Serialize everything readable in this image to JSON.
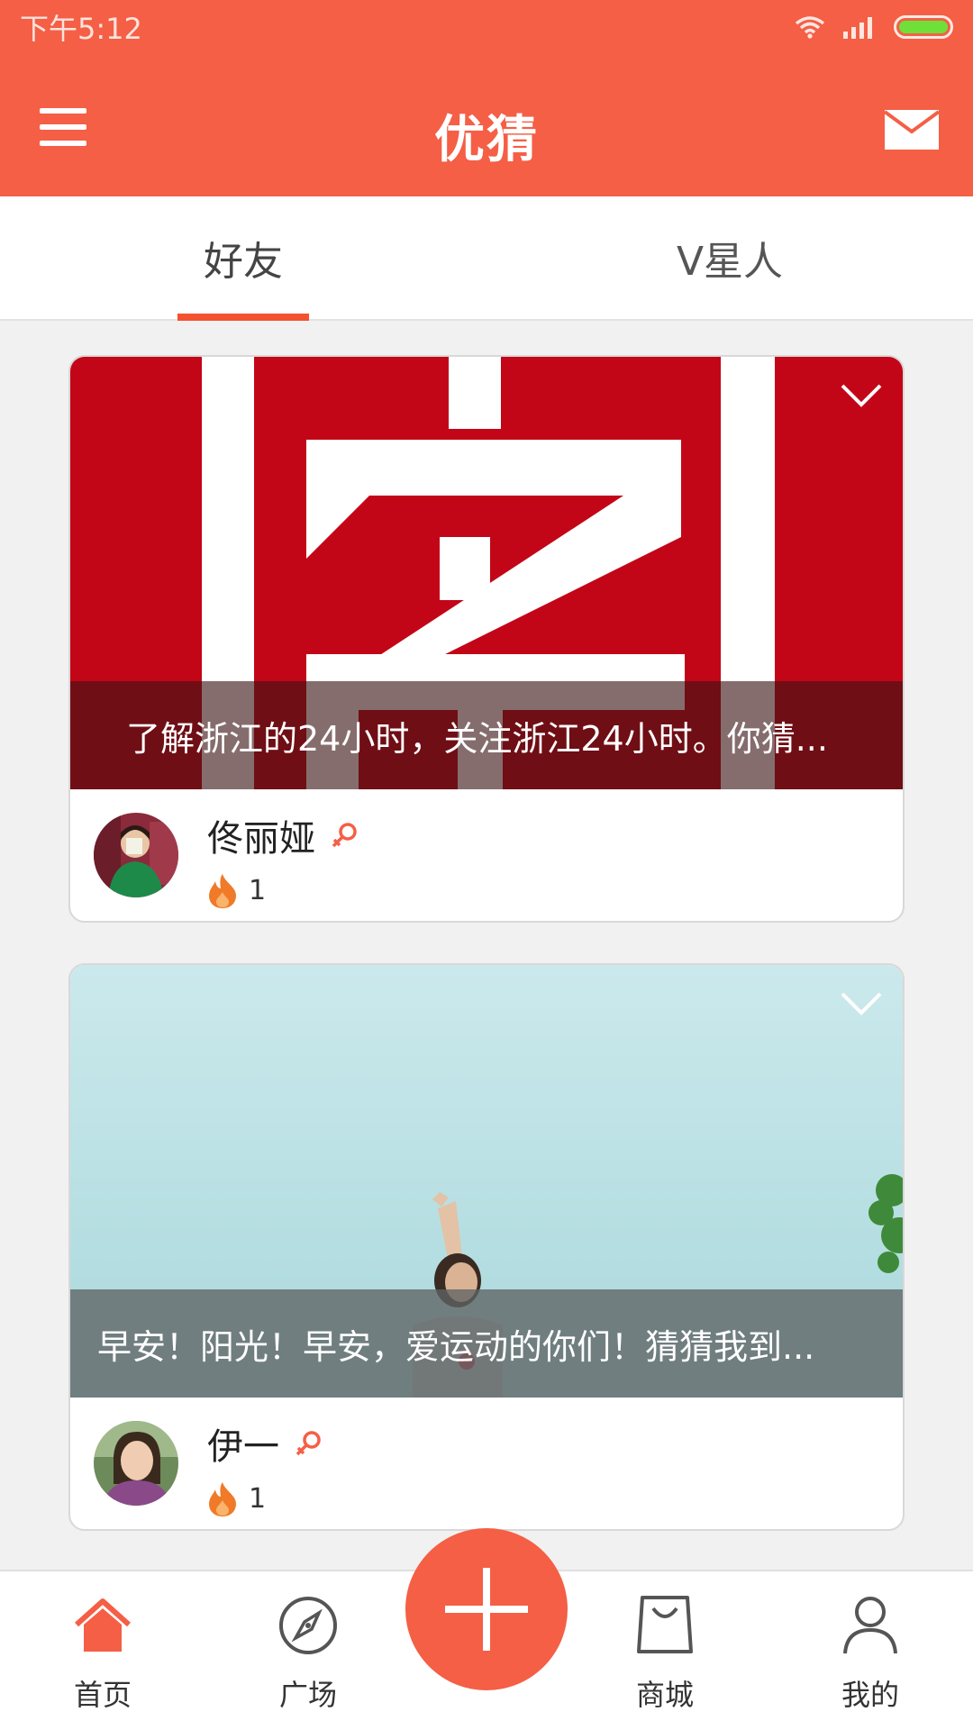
{
  "status_bar": {
    "time": "下午5:12"
  },
  "app": {
    "title": "优猜"
  },
  "tabs": [
    {
      "label": "好友",
      "active": true
    },
    {
      "label": "V星人",
      "active": false
    }
  ],
  "posts": [
    {
      "caption": "了解浙江的24小时，关注浙江24小时。你猜...",
      "user": "佟丽娅",
      "heat": "1",
      "image_icon": "zhejiang-24h-logo"
    },
    {
      "caption": "早安！阳光！早安，爱运动的你们！猜猜我到...",
      "user": "伊一",
      "heat": "1",
      "image_icon": "sky-photo"
    }
  ],
  "bottom_nav": [
    {
      "label": "首页",
      "icon": "home-icon",
      "active": true
    },
    {
      "label": "广场",
      "icon": "compass-icon",
      "active": false
    },
    {
      "label": "商城",
      "icon": "shopping-bag-icon",
      "active": false
    },
    {
      "label": "我的",
      "icon": "person-icon",
      "active": false
    }
  ],
  "colors": {
    "brand": "#f45f46",
    "tab_indicator": "#f4512f",
    "battery": "#6fe03a"
  }
}
